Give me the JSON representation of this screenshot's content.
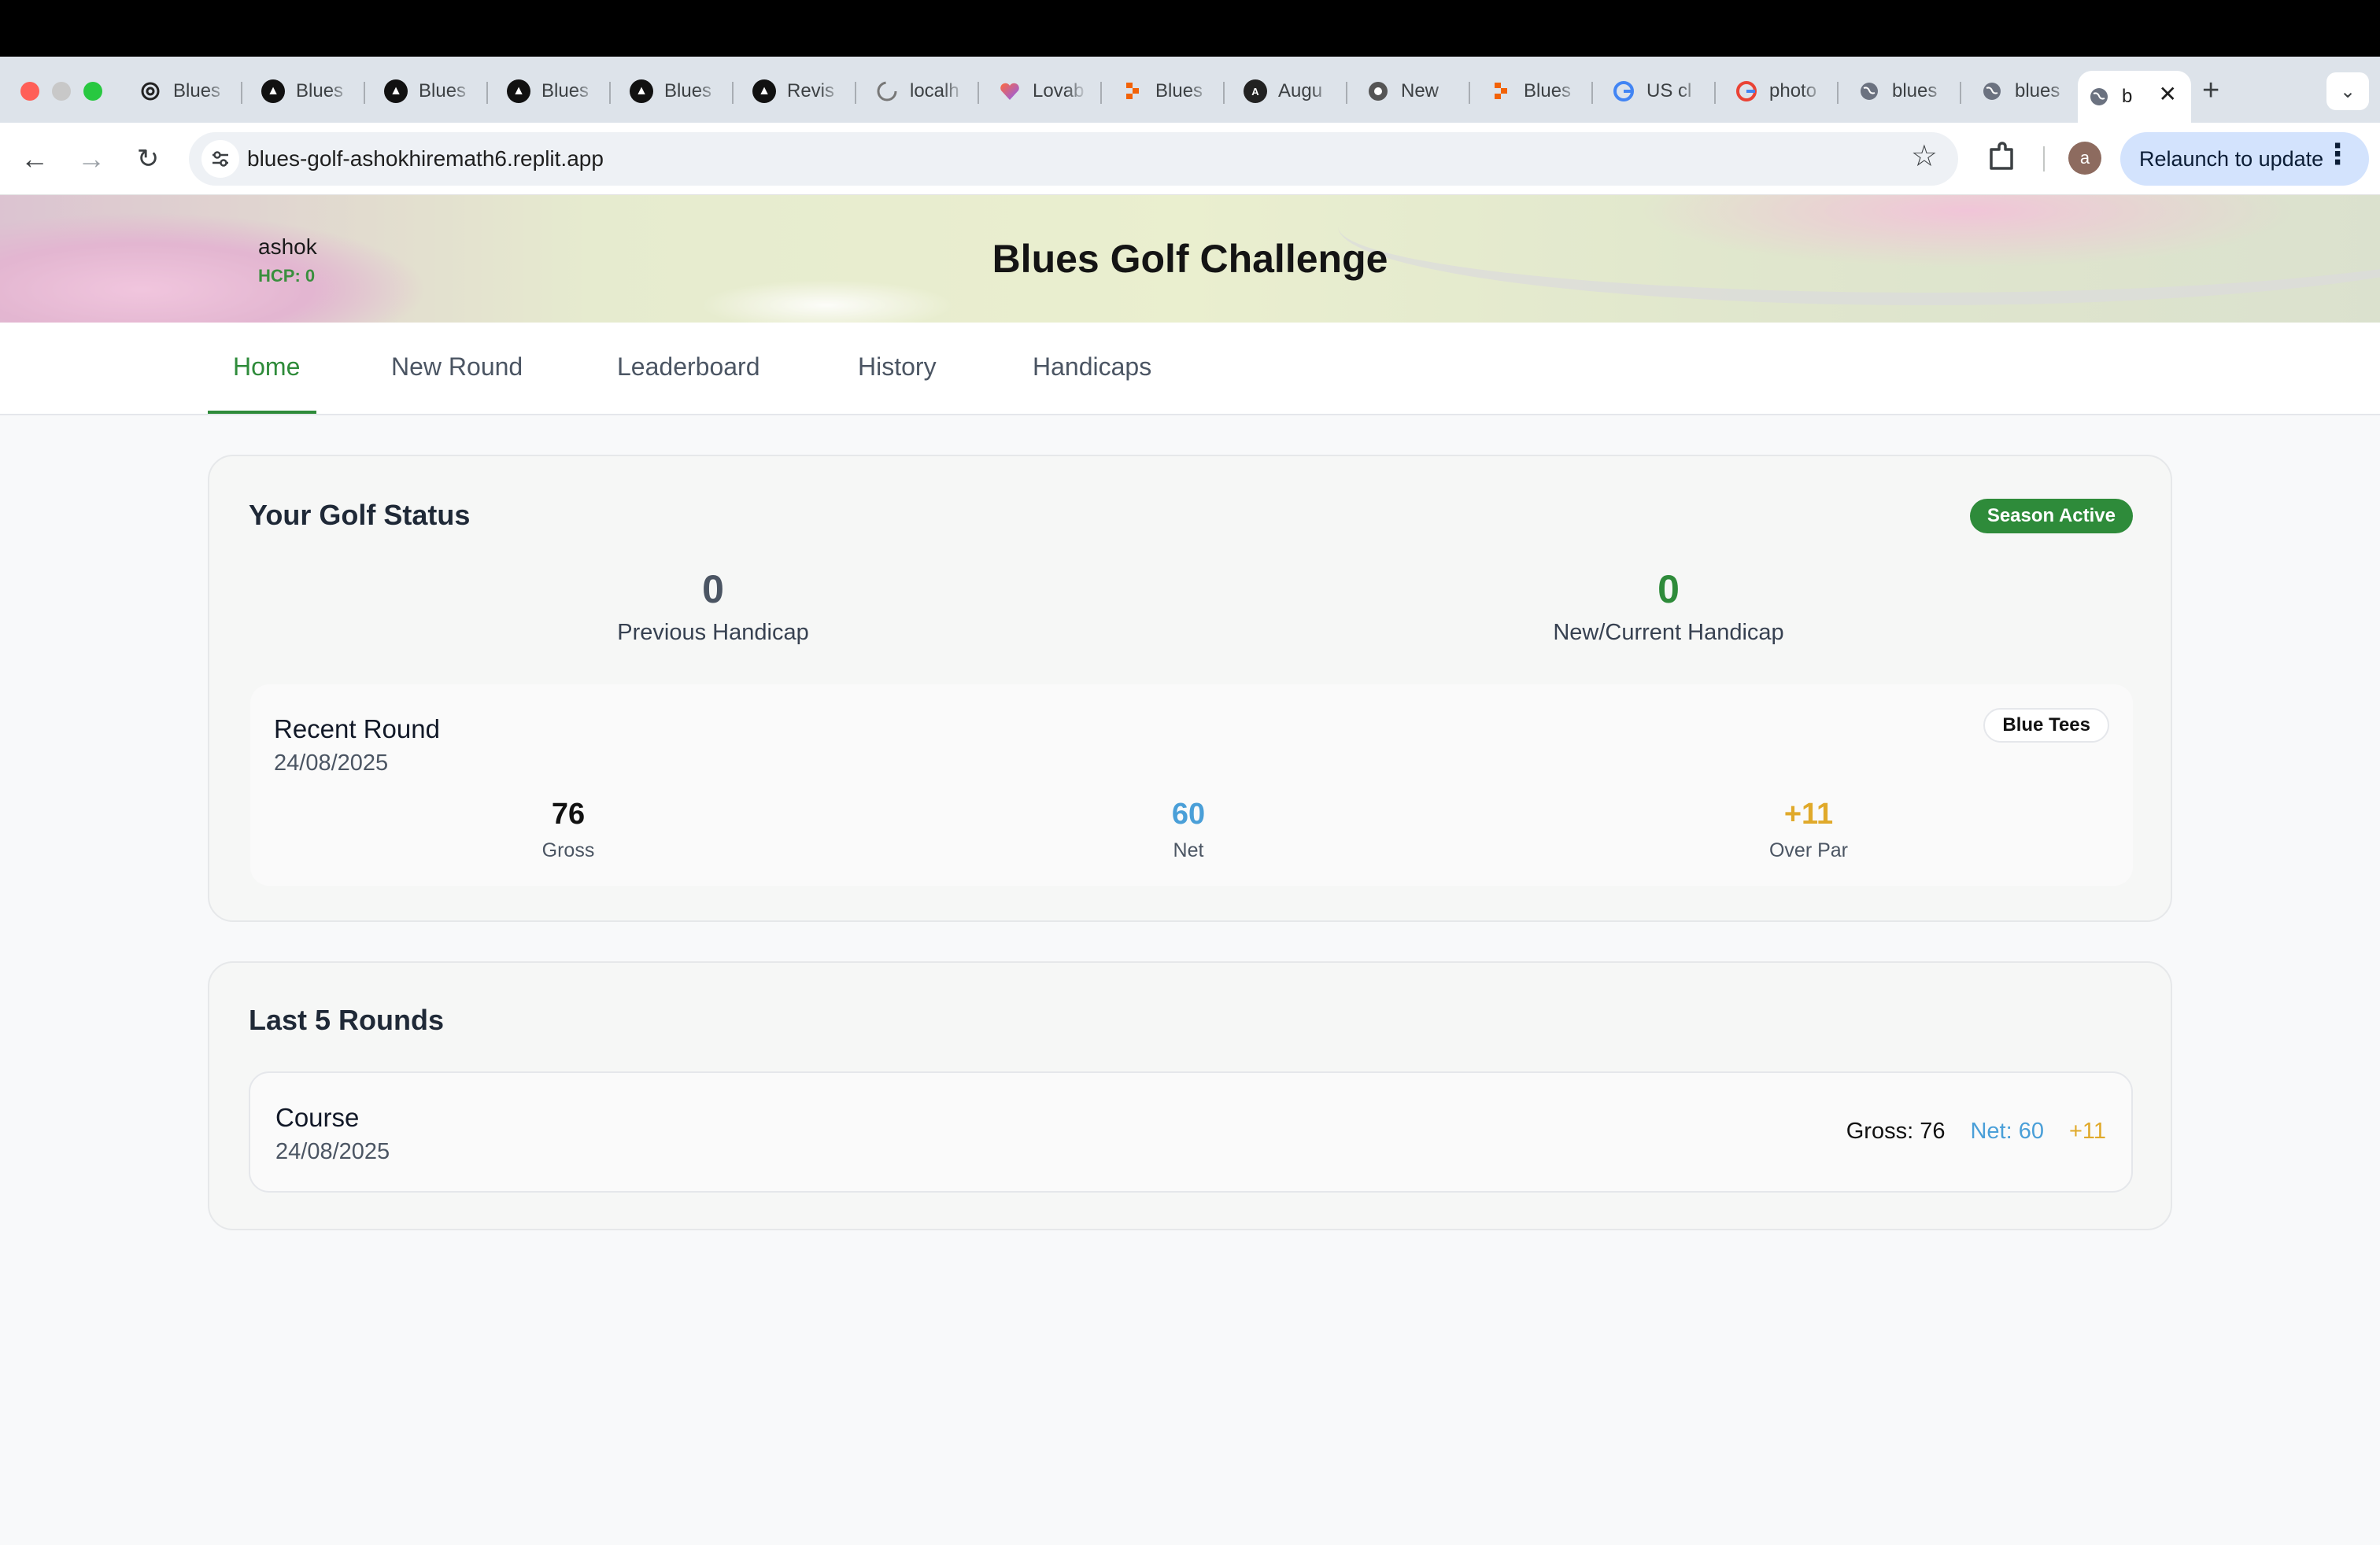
{
  "browser": {
    "tabs": [
      {
        "label": "Blues",
        "icon": "openai-icon"
      },
      {
        "label": "Blues",
        "icon": "a-logo-icon"
      },
      {
        "label": "Blues",
        "icon": "a-logo-icon"
      },
      {
        "label": "Blues",
        "icon": "a-logo-icon"
      },
      {
        "label": "Blues",
        "icon": "a-logo-icon"
      },
      {
        "label": "Revis",
        "icon": "a-logo-icon"
      },
      {
        "label": "localh",
        "icon": "loading-globe-icon"
      },
      {
        "label": "Lovab",
        "icon": "lovable-heart-icon"
      },
      {
        "label": "Blues",
        "icon": "replit-icon"
      },
      {
        "label": "Augu",
        "icon": "augment-icon"
      },
      {
        "label": "New",
        "icon": "chrome-icon"
      },
      {
        "label": "Blues",
        "icon": "replit-icon"
      },
      {
        "label": "US cl",
        "icon": "google-icon"
      },
      {
        "label": "photo",
        "icon": "google-icon"
      },
      {
        "label": "blues",
        "icon": "globe-icon"
      },
      {
        "label": "blues",
        "icon": "globe-icon"
      }
    ],
    "active_tab": {
      "label": "b",
      "icon": "globe-icon"
    },
    "url": "blues-golf-ashokhiremath6.replit.app",
    "avatar_letter": "a",
    "relaunch_label": "Relaunch to update"
  },
  "app": {
    "title": "Blues Golf Challenge",
    "user": {
      "name": "ashok",
      "hcp": "HCP: 0"
    },
    "nav": [
      "Home",
      "New Round",
      "Leaderboard",
      "History",
      "Handicaps"
    ],
    "active_nav": "Home"
  },
  "status": {
    "title": "Your Golf Status",
    "badge": "Season Active",
    "previous_handicap": {
      "value": "0",
      "label": "Previous Handicap"
    },
    "current_handicap": {
      "value": "0",
      "label": "New/Current Handicap"
    },
    "recent_round": {
      "title": "Recent Round",
      "date": "24/08/2025",
      "tees": "Blue Tees",
      "gross": {
        "value": "76",
        "label": "Gross"
      },
      "net": {
        "value": "60",
        "label": "Net"
      },
      "over_par": {
        "value": "+11",
        "label": "Over Par"
      }
    }
  },
  "last_rounds": {
    "title": "Last 5 Rounds",
    "items": [
      {
        "course": "Course",
        "date": "24/08/2025",
        "gross": "Gross: 76",
        "net": "Net: 60",
        "over_par": "+11"
      }
    ]
  },
  "colors": {
    "accent_green": "#2e8b3a",
    "net_blue": "#4a9fd8",
    "over_par_gold": "#e0a92a",
    "neutral_value": "#4b5563"
  }
}
